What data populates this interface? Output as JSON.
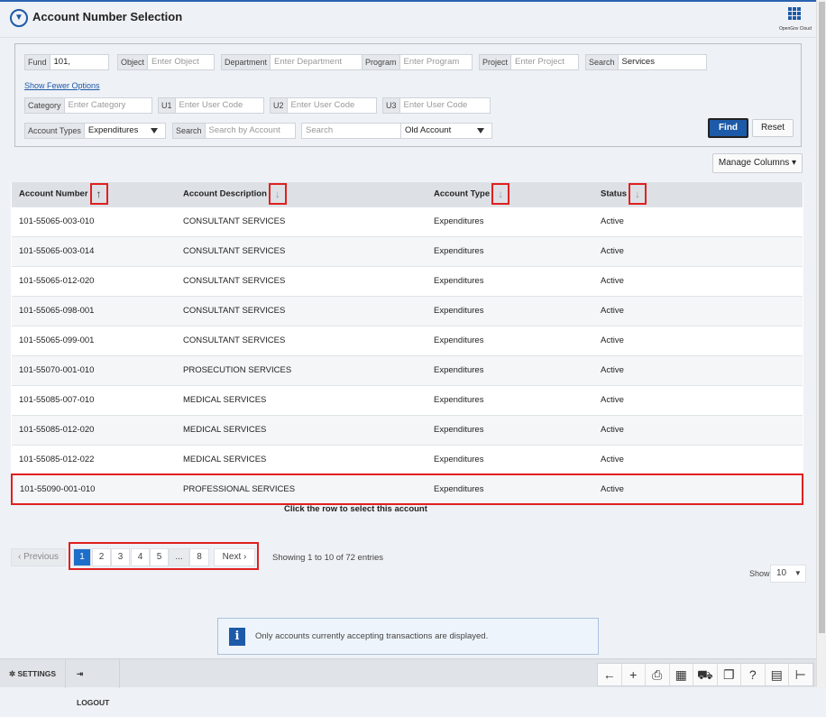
{
  "header": {
    "title": "Account Number Selection",
    "brand": "OpenGov Cloud",
    "logo_icon": "filter-circle-icon",
    "apps_icon": "grid-icon"
  },
  "filters": {
    "fund": {
      "label": "Fund",
      "value": "101,"
    },
    "object": {
      "label": "Object",
      "placeholder": "Enter Object"
    },
    "department": {
      "label": "Department",
      "placeholder": "Enter Department"
    },
    "program": {
      "label": "Program",
      "placeholder": "Enter Program"
    },
    "project": {
      "label": "Project",
      "placeholder": "Enter Project"
    },
    "search": {
      "label": "Search",
      "value": "Services"
    },
    "toggle_link": "Show Fewer Options",
    "category": {
      "label": "Category",
      "placeholder": "Enter Category"
    },
    "u1": {
      "label": "U1",
      "placeholder": "Enter User Code"
    },
    "u2": {
      "label": "U2",
      "placeholder": "Enter User Code"
    },
    "u3": {
      "label": "U3",
      "placeholder": "Enter User Code"
    },
    "account_types": {
      "label": "Account Types",
      "value": "Expenditures"
    },
    "search_account": {
      "label": "Search",
      "placeholder": "Search by Account"
    },
    "search_old": {
      "placeholder": "Search",
      "value": "Old Account"
    },
    "find": "Find",
    "reset": "Reset"
  },
  "manage_columns": "Manage Columns",
  "table": {
    "columns": [
      "Account Number",
      "Account Description",
      "Account  Type",
      "Status"
    ],
    "rows": [
      [
        "101-55065-003-010",
        "CONSULTANT SERVICES",
        "Expenditures",
        "Active"
      ],
      [
        "101-55065-003-014",
        "CONSULTANT SERVICES",
        "Expenditures",
        "Active"
      ],
      [
        "101-55065-012-020",
        "CONSULTANT SERVICES",
        "Expenditures",
        "Active"
      ],
      [
        "101-55065-098-001",
        "CONSULTANT SERVICES",
        "Expenditures",
        "Active"
      ],
      [
        "101-55065-099-001",
        "CONSULTANT SERVICES",
        "Expenditures",
        "Active"
      ],
      [
        "101-55070-001-010",
        "PROSECUTION SERVICES",
        "Expenditures",
        "Active"
      ],
      [
        "101-55085-007-010",
        "MEDICAL SERVICES",
        "Expenditures",
        "Active"
      ],
      [
        "101-55085-012-020",
        "MEDICAL SERVICES",
        "Expenditures",
        "Active"
      ],
      [
        "101-55085-012-022",
        "MEDICAL SERVICES",
        "Expenditures",
        "Active"
      ],
      [
        "101-55090-001-010",
        "PROFESSIONAL SERVICES",
        "Expenditures",
        "Active"
      ]
    ]
  },
  "caption": "Click the row to select this account",
  "pagination": {
    "previous": "‹ Previous",
    "pages": [
      "1",
      "2",
      "3",
      "4",
      "5",
      "...",
      "8"
    ],
    "current": "1",
    "next": "Next ›",
    "summary": "Showing 1 to 10 of 72 entries",
    "show_label": "Show",
    "show_value": "10"
  },
  "info": "Only accounts currently accepting transactions are displayed.",
  "footer": {
    "settings": "SETTINGS",
    "logout": "LOGOUT"
  },
  "colors": {
    "accent": "#1d5aa8",
    "highlight": "#e02020"
  }
}
